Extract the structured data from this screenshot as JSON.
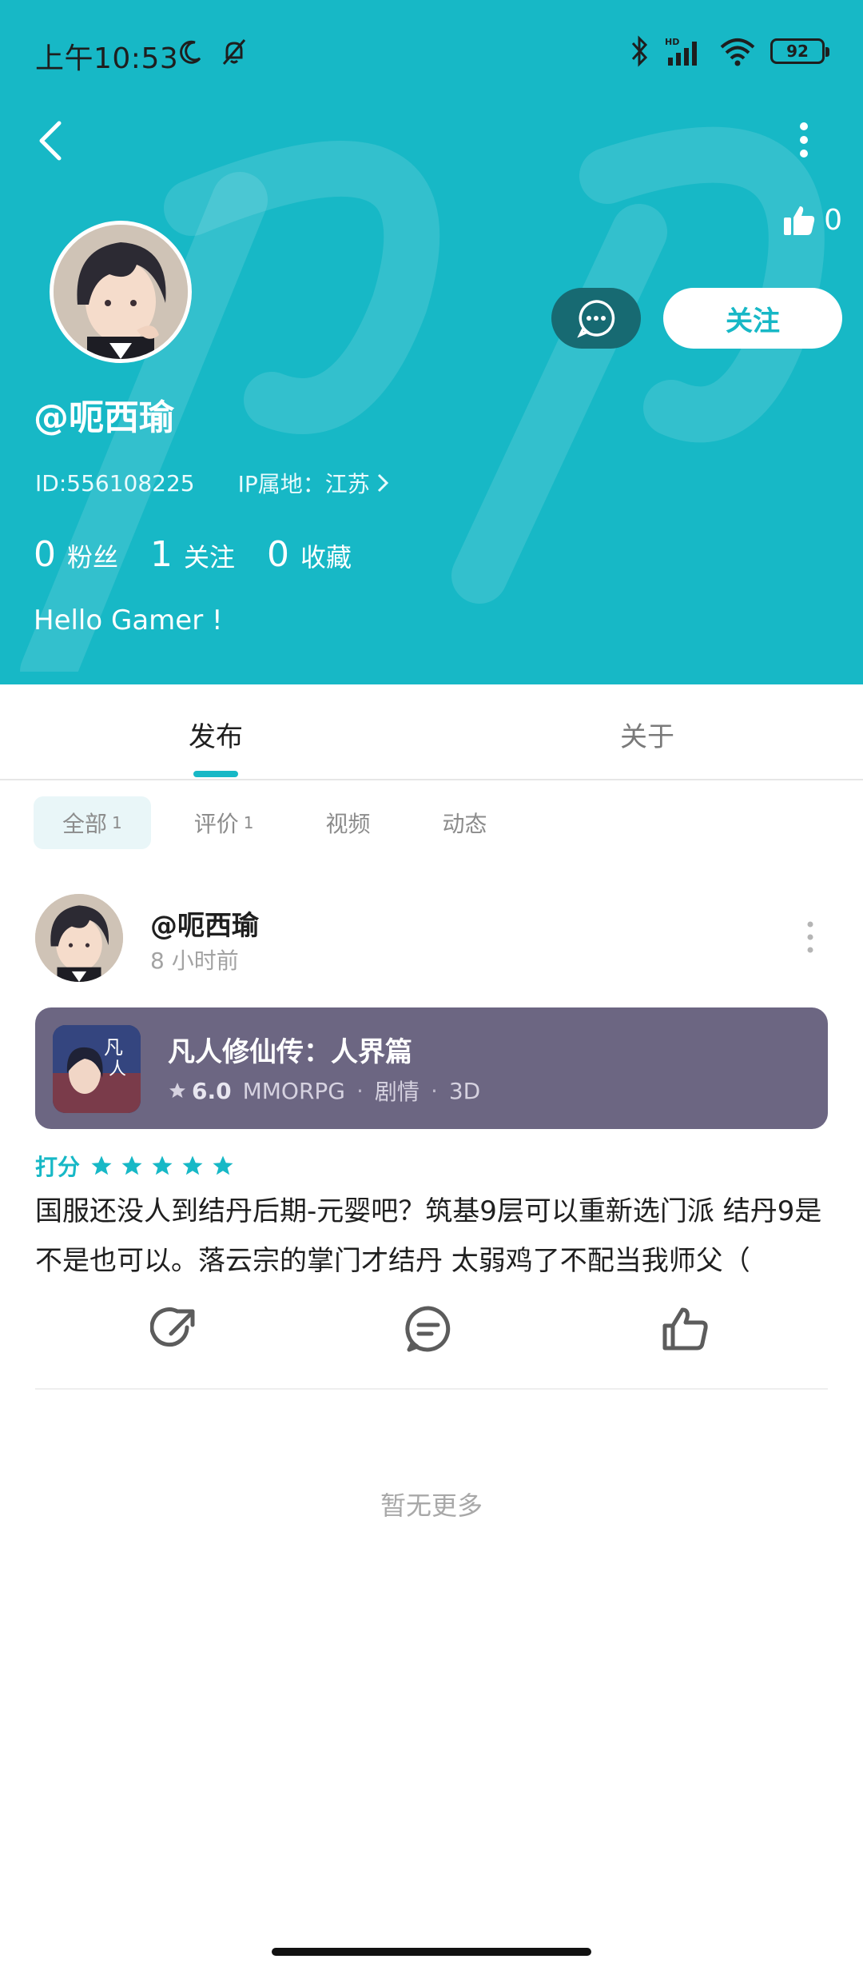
{
  "status_bar": {
    "time": "上午10:53",
    "battery": "92",
    "icons": [
      "moon-icon",
      "bell-off-icon",
      "bluetooth-icon",
      "signal-icon",
      "wifi-icon"
    ]
  },
  "header": {
    "like_count": "0",
    "username": "@呃西瑜",
    "follow_label": "关注",
    "id_text": "ID:556108225",
    "ip_text": "IP属地：江苏",
    "stats": [
      {
        "num": "0",
        "label": "粉丝"
      },
      {
        "num": "1",
        "label": "关注"
      },
      {
        "num": "0",
        "label": "收藏"
      }
    ],
    "bio": "Hello Gamer !",
    "accent_color": "#17b8c6"
  },
  "tabs": [
    {
      "label": "发布",
      "active": true
    },
    {
      "label": "关于",
      "active": false
    }
  ],
  "filters": [
    {
      "label": "全部",
      "count": "1",
      "active": true
    },
    {
      "label": "评价",
      "count": "1",
      "active": false
    },
    {
      "label": "视频",
      "count": "",
      "active": false
    },
    {
      "label": "动态",
      "count": "",
      "active": false
    }
  ],
  "post": {
    "user": "@呃西瑜",
    "time": "8 小时前",
    "game": {
      "title": "凡人修仙传：人界篇",
      "score": "6.0",
      "tags": [
        "MMORPG",
        "剧情",
        "3D"
      ]
    },
    "rating_label": "打分",
    "stars": 5,
    "text": "国服还没人到结丹后期-元婴吧？筑基9层可以重新选门派 结丹9是不是也可以。落云宗的掌门才结丹 太弱鸡了不配当我师父（"
  },
  "footer": {
    "no_more": "暂无更多"
  }
}
